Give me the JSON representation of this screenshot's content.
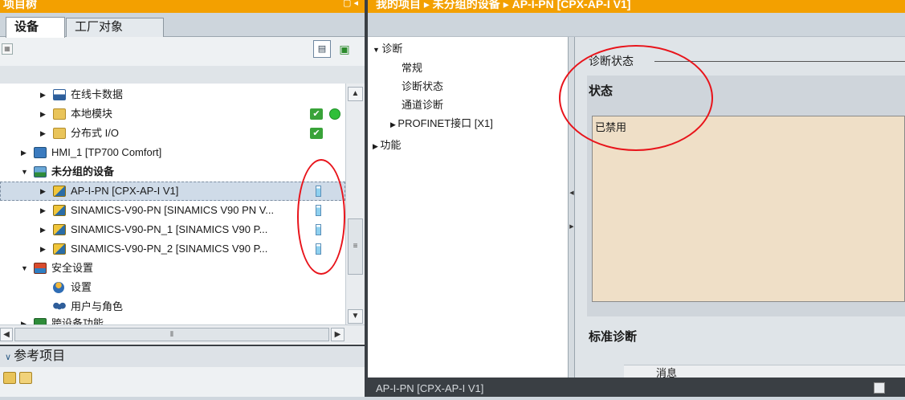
{
  "left_panel": {
    "title": "项目树",
    "tabs": [
      {
        "label": "设备"
      },
      {
        "label": "工厂对象"
      }
    ]
  },
  "tree": [
    {
      "label": "在线卡数据",
      "icon": "card-icon"
    },
    {
      "label": "本地模块",
      "icon": "folder-icon"
    },
    {
      "label": "分布式 I/O",
      "icon": "folder-icon"
    },
    {
      "label": "HMI_1 [TP700 Comfort]",
      "icon": "hmi-icon"
    },
    {
      "label": "未分组的设备",
      "icon": "device-group-icon"
    },
    {
      "label": "AP-I-PN [CPX-AP-I V1]",
      "icon": "profinet-device-icon"
    },
    {
      "label": "SINAMICS-V90-PN [SINAMICS V90 PN V...",
      "icon": "profinet-device-icon"
    },
    {
      "label": "SINAMICS-V90-PN_1 [SINAMICS V90 P...",
      "icon": "profinet-device-icon"
    },
    {
      "label": "SINAMICS-V90-PN_2 [SINAMICS V90 P...",
      "icon": "profinet-device-icon"
    },
    {
      "label": "安全设置",
      "icon": "security-icon"
    },
    {
      "label": "设置",
      "icon": "user-settings-icon"
    },
    {
      "label": "用户与角色",
      "icon": "users-icon"
    },
    {
      "label": "跨设备功能",
      "icon": "cross-device-icon"
    }
  ],
  "reference_panel": {
    "title": "参考项目"
  },
  "editor": {
    "breadcrumb": "我的项目 ▸ 未分组的设备 ▸ AP-I-PN [CPX-AP-I V1]",
    "nav": [
      {
        "label": "诊断"
      },
      {
        "label": "常规"
      },
      {
        "label": "诊断状态"
      },
      {
        "label": "通道诊断"
      },
      {
        "label": "PROFINET接口 [X1]"
      },
      {
        "label": "功能"
      }
    ],
    "section_caption": "诊断状态",
    "status_header": "状态",
    "status_value": "已禁用",
    "std_diag_header": "标准诊断",
    "message_column": "消息"
  },
  "bottom_bar": {
    "label": "AP-I-PN [CPX-AP-I V1]"
  },
  "colors": {
    "title_bar": "#f3a000",
    "selected_row": "#cfdbe8",
    "status_box": "#efdfc7",
    "highlight_oval": "#e8141b"
  }
}
